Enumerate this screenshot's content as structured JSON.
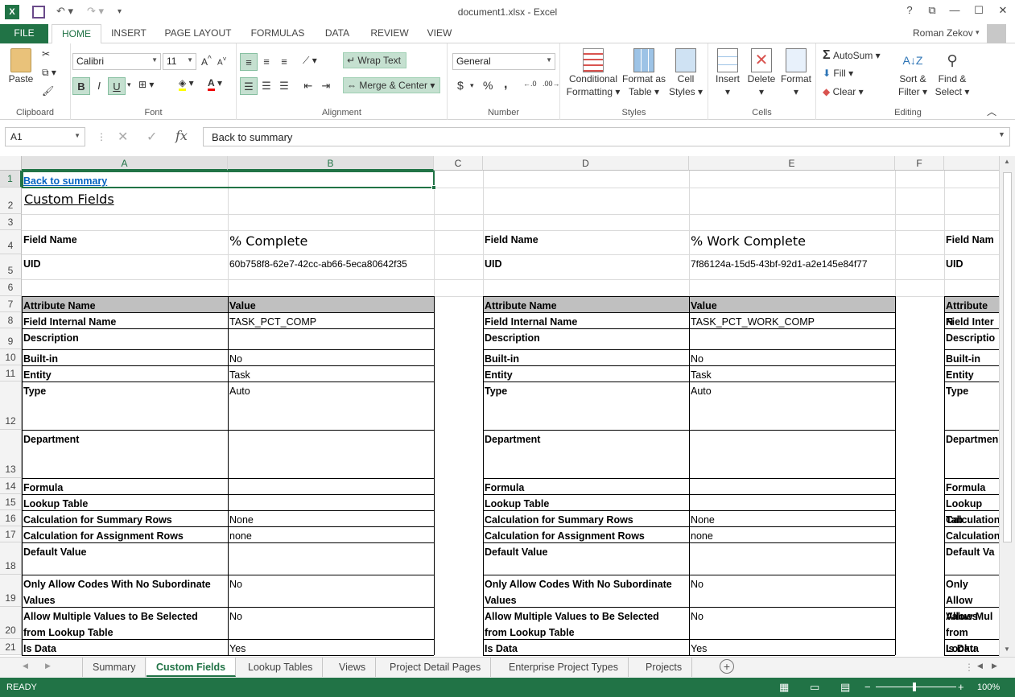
{
  "window": {
    "title": "document1.xlsx - Excel",
    "user": "Roman Zekov",
    "help_glyph": "?"
  },
  "tabs": [
    "FILE",
    "HOME",
    "INSERT",
    "PAGE LAYOUT",
    "FORMULAS",
    "DATA",
    "REVIEW",
    "VIEW"
  ],
  "ribbon": {
    "clipboard": {
      "label": "Clipboard",
      "paste": "Paste"
    },
    "font": {
      "label": "Font",
      "name": "Calibri",
      "size": "11",
      "bold": "B",
      "italic": "I",
      "underline": "U"
    },
    "alignment": {
      "label": "Alignment",
      "wrap": "Wrap Text",
      "merge": "Merge & Center"
    },
    "number": {
      "label": "Number",
      "format": "General",
      "currency": "$",
      "percent": "%",
      "comma": ","
    },
    "styles": {
      "label": "Styles",
      "conditional": [
        "Conditional",
        "Formatting"
      ],
      "format_table": [
        "Format as",
        "Table"
      ],
      "cell_styles": [
        "Cell",
        "Styles"
      ]
    },
    "cells": {
      "label": "Cells",
      "insert": "Insert",
      "delete": "Delete",
      "format": "Format"
    },
    "editing": {
      "label": "Editing",
      "autosum": "AutoSum",
      "fill": "Fill",
      "clear": "Clear",
      "sort": [
        "Sort &",
        "Filter"
      ],
      "find": [
        "Find &",
        "Select"
      ]
    }
  },
  "formula_bar": {
    "name_box": "A1",
    "fx": "fx",
    "content": "Back to summary"
  },
  "columns": [
    "A",
    "B",
    "C",
    "D",
    "E",
    "F"
  ],
  "rows": [
    "1",
    "2",
    "3",
    "4",
    "5",
    "6",
    "7",
    "8",
    "9",
    "10",
    "11",
    "12",
    "13",
    "14",
    "15",
    "16",
    "17",
    "18",
    "19",
    "20",
    "21"
  ],
  "sheet": {
    "back_link": "Back to summary",
    "heading": "Custom Fields",
    "field_name_label": "Field Name",
    "uid_label": "UID",
    "fields": [
      {
        "name": "% Complete",
        "uid": "60b758f8-62e7-42cc-ab66-5eca80642f35",
        "internal": "TASK_PCT_COMP",
        "builtin": "No",
        "entity": "Task",
        "type": "Auto",
        "calc_summary": "None",
        "calc_assignment": "none",
        "only_codes": "No",
        "multi_values": "No",
        "is_data": "Yes"
      },
      {
        "name": "% Work Complete",
        "uid": "7f86124a-15d5-43bf-92d1-a2e145e84f77",
        "internal": "TASK_PCT_WORK_COMP",
        "builtin": "No",
        "entity": "Task",
        "type": "Auto",
        "calc_summary": "None",
        "calc_assignment": "none",
        "only_codes": "No",
        "multi_values": "No",
        "is_data": "Yes"
      }
    ],
    "third_block": {
      "field_name": "Field Nam",
      "attribute": "Attribute N",
      "internal": "Field Inter",
      "description": "Descriptio",
      "builtin": "Built-in",
      "entity": "Entity",
      "type": "Type",
      "department": "Departmen",
      "formula": "Formula",
      "lookup": "Lookup Tab",
      "calc_summary": "Calculation",
      "calc_assignment": "Calculation",
      "default": "Default Va",
      "only_codes": [
        "Only Allow",
        "Values"
      ],
      "multi_values": [
        "Allow Mul",
        "from Looku"
      ],
      "is_data": "Is Data"
    },
    "table_header": {
      "attribute": "Attribute Name",
      "value": "Value"
    },
    "attributes": {
      "internal": "Field Internal Name",
      "description": "Description",
      "builtin": "Built-in",
      "entity": "Entity",
      "type": "Type",
      "department": "Department",
      "formula": "Formula",
      "lookup": "Lookup Table",
      "calc_summary": "Calculation for Summary Rows",
      "calc_assignment": "Calculation for Assignment Rows",
      "default": "Default Value",
      "only_codes": [
        "Only Allow Codes With No Subordinate",
        "Values"
      ],
      "multi_values": [
        "Allow Multiple Values to Be Selected",
        "from Lookup Table"
      ],
      "is_data": "Is Data"
    }
  },
  "sheet_tabs": [
    "Summary",
    "Custom Fields",
    "Lookup Tables",
    "Views",
    "Project Detail Pages",
    "Enterprise Project Types",
    "Projects"
  ],
  "status": {
    "mode": "READY",
    "zoom": "100%"
  },
  "colors": {
    "accent": "#217346",
    "header_fill": "#c0c0c0",
    "link": "#0563c1"
  }
}
